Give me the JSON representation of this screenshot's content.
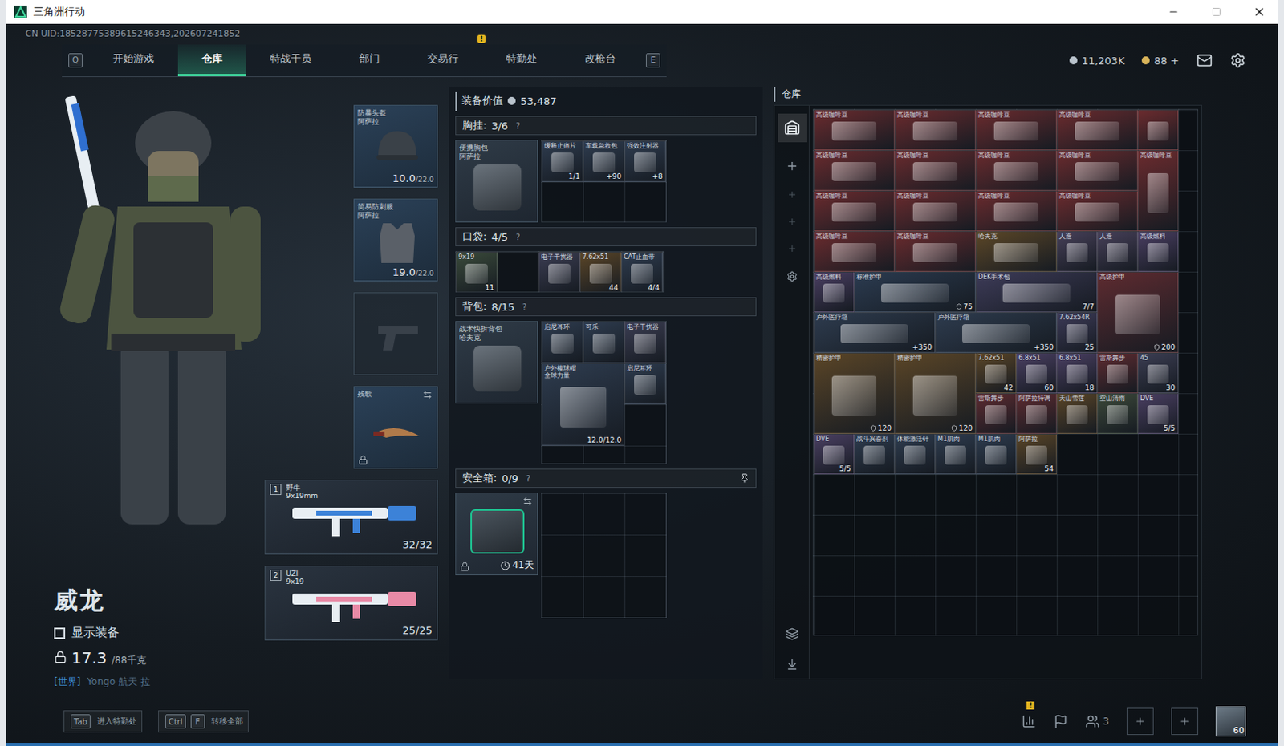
{
  "window": {
    "title": "三角洲行动",
    "controls": [
      "—",
      "☐",
      "✕"
    ]
  },
  "uid": "CN UID:18528775389615246343,202607241852",
  "nav": {
    "left_key": "Q",
    "right_key": "E",
    "tabs": [
      {
        "label": "开始游戏",
        "selected": false,
        "badge": ""
      },
      {
        "label": "仓库",
        "selected": true,
        "badge": ""
      },
      {
        "label": "特战干员",
        "selected": false,
        "badge": ""
      },
      {
        "label": "部门",
        "selected": false,
        "badge": ""
      },
      {
        "label": "交易行",
        "selected": false,
        "badge": ""
      },
      {
        "label": "特勤处",
        "selected": false,
        "badge": "!"
      },
      {
        "label": "改枪台",
        "selected": false,
        "badge": ""
      }
    ]
  },
  "currency": [
    {
      "value": "11,203K",
      "color": "#b9c3cc"
    },
    {
      "value": "88 +",
      "color": "#d9b45a"
    }
  ],
  "operator": {
    "name": "威龙",
    "show_gear": {
      "label": "显示装备",
      "checked": false
    },
    "weight": "17.3",
    "weight_max": "/88千克",
    "chat": {
      "channel": "[世界]",
      "text": "Yongo 航天 拉"
    }
  },
  "slots": [
    {
      "name": "防暴头盔",
      "brand": "阿萨拉",
      "value": "10.0",
      "max": "/22.0",
      "kind": "helmet",
      "locked": false
    },
    {
      "name": "简易防刺服",
      "brand": "阿萨拉",
      "value": "19.0",
      "max": "/22.0",
      "kind": "armor",
      "locked": false
    },
    {
      "name": "",
      "brand": "",
      "value": "",
      "max": "",
      "kind": "pistol",
      "locked": false
    },
    {
      "name": "残歌",
      "brand": "",
      "value": "",
      "max": "",
      "kind": "melee",
      "locked": true
    }
  ],
  "weapons": [
    {
      "index": "1",
      "name": "野牛",
      "caliber": "9x19mm",
      "ammo": "32/32",
      "color": "#3c82d8"
    },
    {
      "index": "2",
      "name": "UZI",
      "caliber": "9x19",
      "ammo": "25/25",
      "color": "#e88aa6"
    }
  ],
  "loadout": {
    "title": "装备价值",
    "value": "53,487",
    "sections": [
      {
        "title": "胸挂:",
        "count": "3/6",
        "help": "?",
        "container": {
          "name": "便携胸包",
          "brand": "阿萨拉"
        },
        "cols": 3,
        "rows": 2,
        "items": [
          {
            "name": "缓释止痛片",
            "count": "1/1",
            "kind": "small",
            "color": "#2e3c4f"
          },
          {
            "name": "车载急救包",
            "count": "+90",
            "kind": "small",
            "color": "#2e3c4f"
          },
          {
            "name": "强效注射器",
            "count": "+8",
            "kind": "small",
            "color": "#2e3c4f"
          }
        ]
      },
      {
        "title": "口袋:",
        "count": "4/5",
        "help": "?",
        "cols": 5,
        "rows": 1,
        "items": [
          {
            "name": "9x19",
            "count": "11",
            "kind": "small",
            "color": "#3a4a3a"
          },
          {
            "name": "",
            "count": "",
            "kind": "empty",
            "color": "#000000"
          },
          {
            "name": "电子干扰器",
            "count": "",
            "kind": "small",
            "color": "#3b3d52"
          },
          {
            "name": "7.62x51",
            "count": "44",
            "kind": "small",
            "color": "#5a4527"
          },
          {
            "name": "CAT止血带",
            "count": "4/4",
            "kind": "small",
            "color": "#2e3c4f"
          }
        ]
      },
      {
        "title": "背包:",
        "count": "8/15",
        "help": "?",
        "container": {
          "name": "战术快拆背包",
          "brand": "哈夫克"
        },
        "cols": 3,
        "rows": 4,
        "items": [
          {
            "name": "启尼耳环",
            "count": "",
            "kind": "small",
            "color": "#2e3c4f"
          },
          {
            "name": "可乐",
            "count": "",
            "kind": "small",
            "color": "#2e3c4f"
          },
          {
            "name": "电子干扰器",
            "count": "",
            "kind": "small",
            "color": "#3b3d52"
          },
          {
            "name": "户外棒球帽",
            "brand": "全球力量",
            "count": "12.0/12.0",
            "kind": "big",
            "color": "#2e3c4f"
          },
          {
            "name": "启尼耳环",
            "count": "",
            "kind": "small",
            "color": "#2e3c4f"
          }
        ]
      }
    ],
    "safe": {
      "title": "安全箱:",
      "count": "0/9",
      "help": "?",
      "days": "41天",
      "locked": true,
      "cols": 3,
      "rows": 3
    }
  },
  "storage": {
    "title": "仓库",
    "items": [
      {
        "name": "高级咖啡豆",
        "count": "",
        "kind": "wide",
        "color": "#6b2b2e"
      },
      {
        "name": "高级咖啡豆",
        "count": "",
        "kind": "wide",
        "color": "#6b2b2e"
      },
      {
        "name": "高级咖啡豆",
        "count": "",
        "kind": "wide",
        "color": "#6b2b2e"
      },
      {
        "name": "高级咖啡豆",
        "count": "",
        "kind": "wide",
        "color": "#6b2b2e"
      },
      {
        "name": "",
        "count": "",
        "kind": "small",
        "color": "#6b2b2e"
      },
      {
        "name": "高级咖啡豆",
        "count": "",
        "kind": "wide",
        "color": "#6b2b2e"
      },
      {
        "name": "高级咖啡豆",
        "count": "",
        "kind": "wide",
        "color": "#6b2b2e"
      },
      {
        "name": "高级咖啡豆",
        "count": "",
        "kind": "wide",
        "color": "#6b2b2e"
      },
      {
        "name": "高级咖啡豆",
        "count": "",
        "kind": "wide",
        "color": "#6b2b2e"
      },
      {
        "name": "高级咖啡豆",
        "count": "",
        "kind": "tall",
        "color": "#6b2b2e"
      },
      {
        "name": "高级咖啡豆",
        "count": "",
        "kind": "wide",
        "color": "#6b2b2e"
      },
      {
        "name": "高级咖啡豆",
        "count": "",
        "kind": "wide",
        "color": "#6b2b2e"
      },
      {
        "name": "高级咖啡豆",
        "count": "",
        "kind": "wide",
        "color": "#6b2b2e"
      },
      {
        "name": "高级咖啡豆",
        "count": "",
        "kind": "wide",
        "color": "#6b2b2e"
      },
      {
        "name": "高级咖啡豆",
        "count": "",
        "kind": "wide",
        "color": "#6b2b2e"
      },
      {
        "name": "高级咖啡豆",
        "count": "",
        "kind": "wide",
        "color": "#6b2b2e"
      },
      {
        "name": "哈夫克",
        "count": "",
        "kind": "wide",
        "color": "#5c4727"
      },
      {
        "name": "人造",
        "count": "",
        "kind": "small",
        "color": "#474059"
      },
      {
        "name": "人造",
        "count": "",
        "kind": "small",
        "color": "#474059"
      },
      {
        "name": "高级燃料",
        "count": "",
        "kind": "small",
        "color": "#4a3e62"
      },
      {
        "name": "高级燃料",
        "count": "",
        "kind": "small",
        "color": "#4a3e62"
      },
      {
        "name": "标准护甲",
        "count": "",
        "durability": "75",
        "kind": "wide3",
        "color": "#2b3b50"
      },
      {
        "name": "DEK手术包",
        "count": "7/7",
        "kind": "wide3",
        "color": "#3d3b58"
      },
      {
        "name": "高级护甲",
        "count": "",
        "durability": "200",
        "kind": "big",
        "color": "#5e2b30"
      },
      {
        "name": "户外医疗箱",
        "count": "+350",
        "kind": "wide3",
        "color": "#2e3c4f"
      },
      {
        "name": "户外医疗箱",
        "count": "+350",
        "kind": "wide3",
        "color": "#2e3c4f"
      },
      {
        "name": "7.62x54R",
        "count": "25",
        "kind": "small",
        "color": "#3d3b58"
      },
      {
        "name": "精密护甲",
        "count": "",
        "durability": "120",
        "kind": "big",
        "color": "#5a4527"
      },
      {
        "name": "精密护甲",
        "count": "",
        "durability": "120",
        "kind": "big",
        "color": "#5a4527"
      },
      {
        "name": "7.62x51",
        "count": "42",
        "kind": "small",
        "color": "#5a4527"
      },
      {
        "name": "6.8x51",
        "count": "60",
        "kind": "small",
        "color": "#4a3f62"
      },
      {
        "name": "6.8x51",
        "count": "18",
        "kind": "small",
        "color": "#4a3f62"
      },
      {
        "name": "雷斯舞步",
        "count": "",
        "kind": "small",
        "color": "#5e2b30"
      },
      {
        "name": "45",
        "count": "30",
        "kind": "small",
        "color": "#3b3d52"
      },
      {
        "name": "雷斯舞步",
        "count": "",
        "kind": "small",
        "color": "#5e2b30"
      },
      {
        "name": "阿萨拉特调",
        "count": "",
        "kind": "small",
        "color": "#5e2b30"
      },
      {
        "name": "天山雪莲",
        "count": "",
        "kind": "small",
        "color": "#5a4527"
      },
      {
        "name": "空山清雨",
        "count": "",
        "kind": "small",
        "color": "#3d4a3a"
      },
      {
        "name": "DVE",
        "count": "5/5",
        "kind": "small",
        "color": "#4a3f62"
      },
      {
        "name": "DVE",
        "count": "5/5",
        "kind": "small",
        "color": "#4a3f62"
      },
      {
        "name": "战斗兴奋剂",
        "count": "",
        "kind": "small",
        "color": "#2e3c4f"
      },
      {
        "name": "体能激活针",
        "count": "",
        "kind": "small",
        "color": "#2e3c4f"
      },
      {
        "name": "M1肌肉",
        "count": "",
        "kind": "small",
        "color": "#2e3c4f"
      },
      {
        "name": "M1肌肉",
        "count": "",
        "kind": "small",
        "color": "#2e3c4f"
      },
      {
        "name": "阿萨拉",
        "count": "54",
        "kind": "small",
        "color": "#5a4527"
      }
    ]
  },
  "bottom": {
    "hints": [
      {
        "keys": [
          "Tab"
        ],
        "label": "进入特勤处"
      },
      {
        "keys": [
          "Ctrl",
          "F"
        ],
        "label": "转移全部"
      }
    ],
    "badge": "!",
    "squad": "3",
    "level": "60"
  }
}
